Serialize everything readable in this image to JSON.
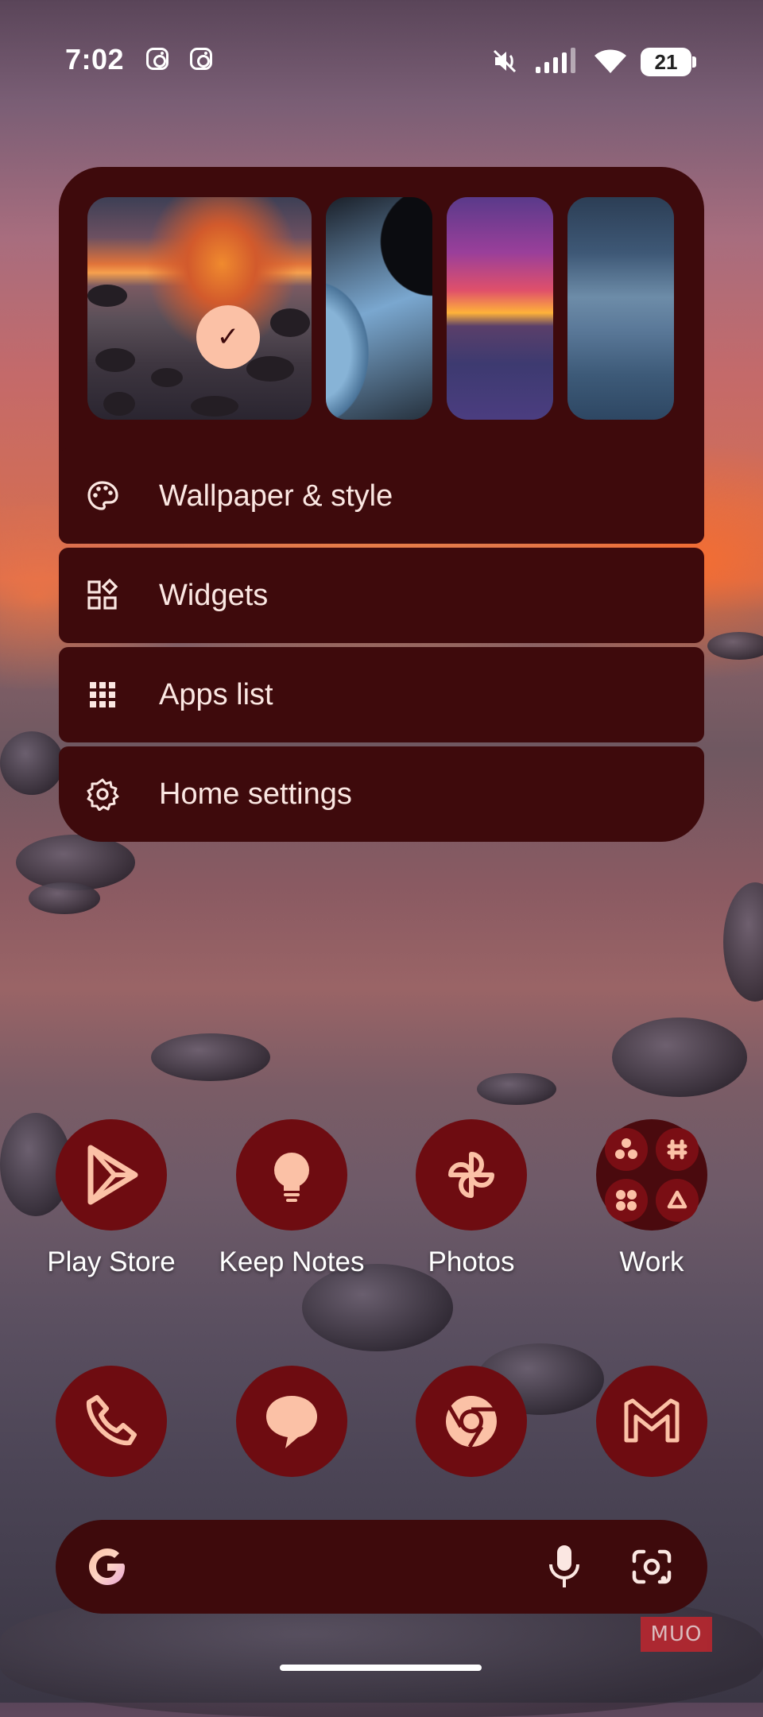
{
  "status_bar": {
    "time": "7:02",
    "battery": "21",
    "icons": [
      "instagram-icon",
      "instagram-icon",
      "mute-icon",
      "signal-icon",
      "wifi-icon",
      "battery-icon"
    ]
  },
  "menu": {
    "wallpapers": [
      {
        "name": "rocky-sunset",
        "selected": true
      },
      {
        "name": "blue-abstract",
        "selected": false
      },
      {
        "name": "purple-sunset",
        "selected": false
      },
      {
        "name": "blue-sea",
        "selected": false
      }
    ],
    "items": [
      {
        "label": "Wallpaper & style",
        "icon": "palette-icon"
      },
      {
        "label": "Widgets",
        "icon": "widgets-icon"
      },
      {
        "label": "Apps list",
        "icon": "grid-icon"
      },
      {
        "label": "Home settings",
        "icon": "gear-icon"
      }
    ]
  },
  "apps": [
    {
      "label": "Play Store",
      "icon": "play-store-icon"
    },
    {
      "label": "Keep Notes",
      "icon": "bulb-icon"
    },
    {
      "label": "Photos",
      "icon": "photos-icon"
    },
    {
      "label": "Work",
      "icon": "folder-icon"
    }
  ],
  "dock": [
    "phone-icon",
    "messages-icon",
    "chrome-icon",
    "gmail-icon"
  ],
  "search": {
    "icons": [
      "google-icon",
      "mic-icon",
      "lens-icon"
    ]
  },
  "watermark": "MUO",
  "colors": {
    "accent": "#6e0c11",
    "menu_bg": "#3e0a0c",
    "icon_fg": "#fbc1a6"
  }
}
